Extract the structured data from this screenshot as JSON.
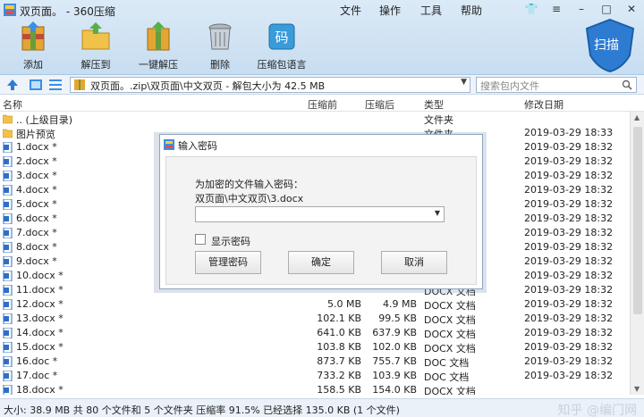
{
  "window": {
    "title": "双页面。 - 360压缩",
    "menu": [
      "文件",
      "操作",
      "工具",
      "帮助"
    ]
  },
  "toolbar": {
    "add": "添加",
    "extract_to": "解压到",
    "one_click": "一键解压",
    "delete": "删除",
    "language": "压缩包语言",
    "scan": "扫描"
  },
  "address": {
    "path": "双页面。.zip\\双页面\\中文双页 - 解包大小为 42.5 MB",
    "search_placeholder": "搜索包内文件"
  },
  "columns": {
    "name": "名称",
    "compressed": "压缩前",
    "original": "压缩后",
    "type": "类型",
    "modified": "修改日期"
  },
  "files": [
    {
      "icon": "folder",
      "name": ".. (上级目录)",
      "comp": "",
      "orig": "",
      "type": "文件夹",
      "date": ""
    },
    {
      "icon": "folder",
      "name": "图片预览",
      "comp": "",
      "orig": "",
      "type": "文件夹",
      "date": "2019-03-29 18:33"
    },
    {
      "icon": "doc",
      "name": "1.docx *",
      "comp": "",
      "orig": "",
      "type": "",
      "date": "2019-03-29 18:32"
    },
    {
      "icon": "doc",
      "name": "2.docx *",
      "comp": "",
      "orig": "",
      "type": "",
      "date": "2019-03-29 18:32"
    },
    {
      "icon": "doc",
      "name": "3.docx *",
      "comp": "",
      "orig": "",
      "type": "",
      "date": "2019-03-29 18:32"
    },
    {
      "icon": "doc",
      "name": "4.docx *",
      "comp": "",
      "orig": "",
      "type": "",
      "date": "2019-03-29 18:32"
    },
    {
      "icon": "doc",
      "name": "5.docx *",
      "comp": "",
      "orig": "",
      "type": "",
      "date": "2019-03-29 18:32"
    },
    {
      "icon": "doc",
      "name": "6.docx *",
      "comp": "",
      "orig": "",
      "type": "",
      "date": "2019-03-29 18:32"
    },
    {
      "icon": "doc",
      "name": "7.docx *",
      "comp": "",
      "orig": "",
      "type": "",
      "date": "2019-03-29 18:32"
    },
    {
      "icon": "doc",
      "name": "8.docx *",
      "comp": "",
      "orig": "",
      "type": "",
      "date": "2019-03-29 18:32"
    },
    {
      "icon": "doc",
      "name": "9.docx *",
      "comp": "",
      "orig": "",
      "type": "",
      "date": "2019-03-29 18:32"
    },
    {
      "icon": "doc",
      "name": "10.docx *",
      "comp": "",
      "orig": "",
      "type": "",
      "date": "2019-03-29 18:32"
    },
    {
      "icon": "doc",
      "name": "11.docx *",
      "comp": "",
      "orig": "",
      "type": "DOCX 文档",
      "date": "2019-03-29 18:32"
    },
    {
      "icon": "doc",
      "name": "12.docx *",
      "comp": "5.0 MB",
      "orig": "4.9 MB",
      "type": "DOCX 文档",
      "date": "2019-03-29 18:32"
    },
    {
      "icon": "doc",
      "name": "13.docx *",
      "comp": "102.1 KB",
      "orig": "99.5 KB",
      "type": "DOCX 文档",
      "date": "2019-03-29 18:32"
    },
    {
      "icon": "doc",
      "name": "14.docx *",
      "comp": "641.0 KB",
      "orig": "637.9 KB",
      "type": "DOCX 文档",
      "date": "2019-03-29 18:32"
    },
    {
      "icon": "doc",
      "name": "15.docx *",
      "comp": "103.8 KB",
      "orig": "102.0 KB",
      "type": "DOCX 文档",
      "date": "2019-03-29 18:32"
    },
    {
      "icon": "doc",
      "name": "16.doc *",
      "comp": "873.7 KB",
      "orig": "755.7 KB",
      "type": "DOC 文档",
      "date": "2019-03-29 18:32"
    },
    {
      "icon": "doc",
      "name": "17.doc *",
      "comp": "733.2 KB",
      "orig": "103.9 KB",
      "type": "DOC 文档",
      "date": "2019-03-29 18:32"
    },
    {
      "icon": "doc",
      "name": "18.docx *",
      "comp": "158.5 KB",
      "orig": "154.0 KB",
      "type": "DOCX 文档",
      "date": ""
    }
  ],
  "status": {
    "text": "大小: 38.9 MB 共 80 个文件和 5 个文件夹 压缩率 91.5% 已经选择 135.0 KB (1 个文件)",
    "watermark": "知乎 @编门网"
  },
  "dialog": {
    "title": "输入密码",
    "prompt": "为加密的文件输入密码：",
    "path": "双页面\\中文双页\\3.docx",
    "password_value": "",
    "show_password": "显示密码",
    "show_password_checked": false,
    "manage": "管理密码",
    "ok": "确定",
    "cancel": "取消"
  },
  "colors": {
    "accent": "#2e7cd1",
    "toolbar_bg": "#c7ddf1"
  }
}
